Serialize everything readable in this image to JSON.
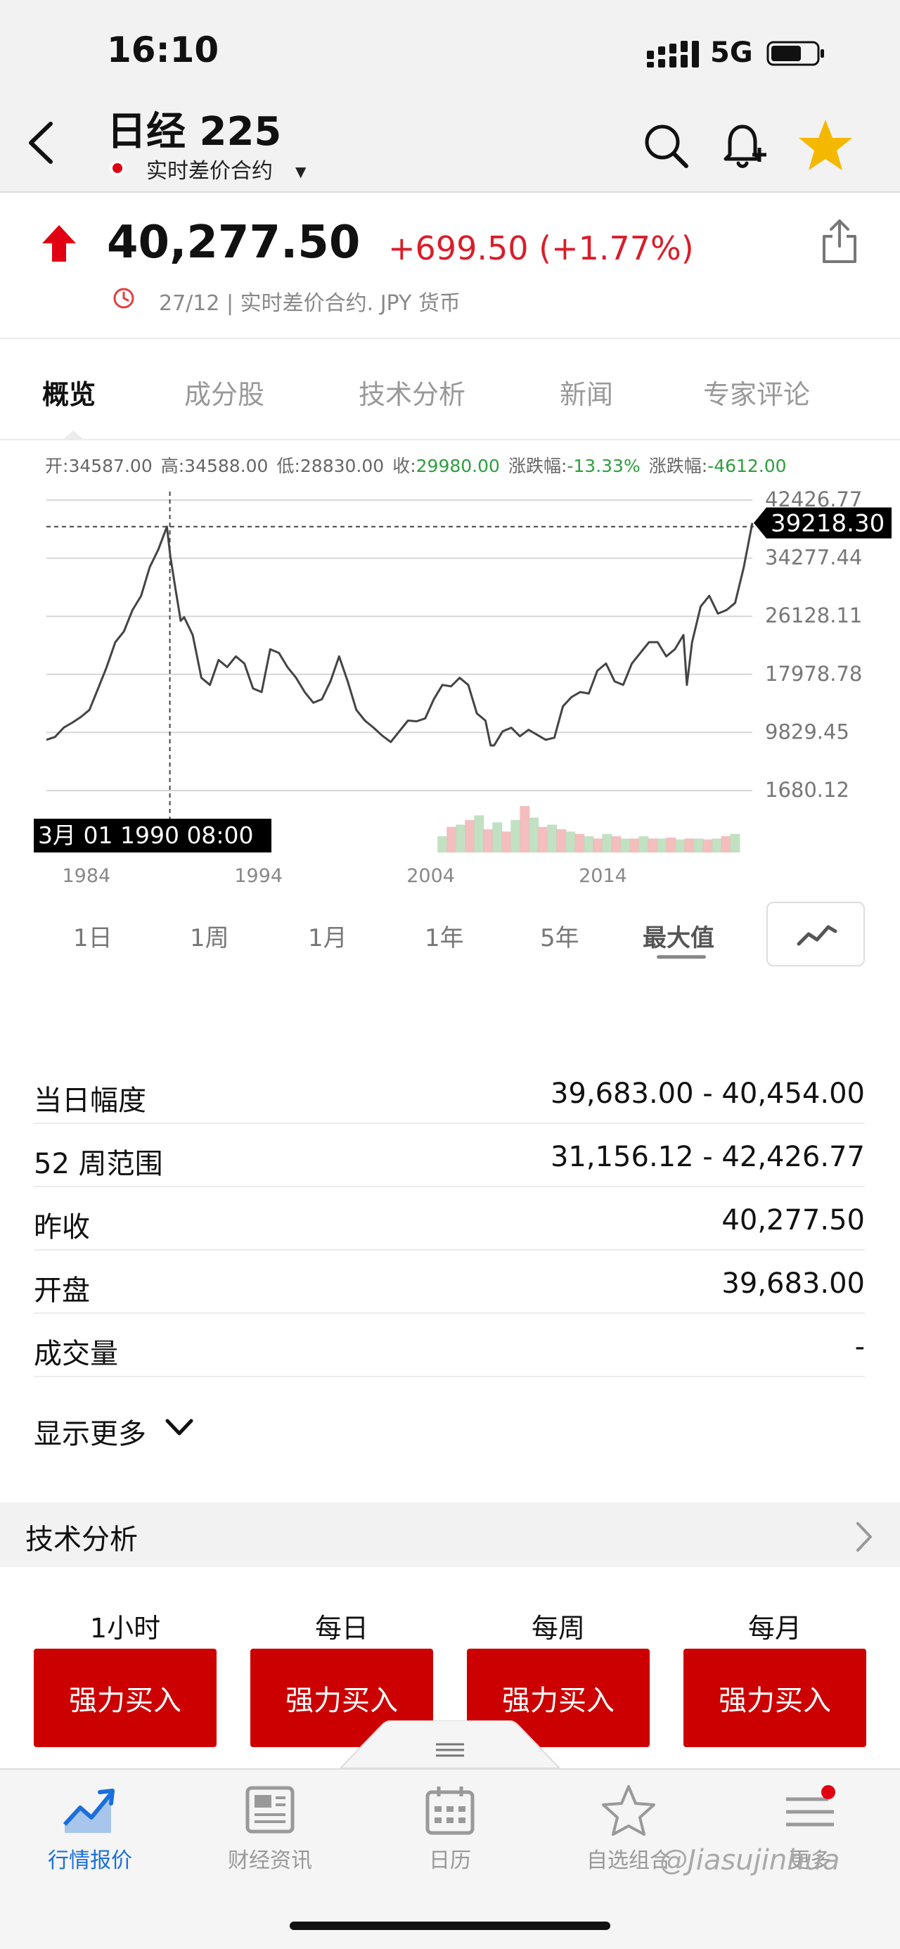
{
  "status": {
    "time": "16:10",
    "network": "5G"
  },
  "header": {
    "title": "日经 225",
    "subtitle": "实时差价合约"
  },
  "quote": {
    "price": "40,277.50",
    "change": "+699.50 (+1.77%)",
    "meta": "27/12 | 实时差价合约. JPY 货币"
  },
  "tabs": [
    {
      "label": "概览",
      "active": true
    },
    {
      "label": "成分股"
    },
    {
      "label": "技术分析"
    },
    {
      "label": "新闻"
    },
    {
      "label": "专家评论"
    }
  ],
  "chart_header": {
    "open_label": "开:",
    "open": "34587.00",
    "high_label": "高:",
    "high": "34588.00",
    "low_label": "低:",
    "low": "28830.00",
    "close_label": "收:",
    "close": "29980.00",
    "pct_label": "涨跌幅:",
    "pct": "-13.33%",
    "chg_label": "涨跌幅:",
    "chg": "-4612.00"
  },
  "chart_data": {
    "type": "line",
    "y_ticks": [
      "42426.77",
      "34277.44",
      "26128.11",
      "17978.78",
      "9829.45",
      "1680.12"
    ],
    "y_tick_values": [
      42426.77,
      34277.44,
      26128.11,
      17978.78,
      9829.45,
      1680.12
    ],
    "ylim": [
      1680.12,
      42426.77
    ],
    "x_ticks": [
      "1984",
      "1994",
      "2004",
      "2014"
    ],
    "x_tick_values": [
      1984,
      1994,
      2004,
      2014
    ],
    "xlim": [
      1983,
      2024
    ],
    "crosshair_label": "3月 01 1990 08:00",
    "crosshair_x": 1990.17,
    "crosshair_y": 38700,
    "last_value_label": "39218.30",
    "last_value": 39218.3,
    "x": [
      1983.0,
      1983.5,
      1984.0,
      1984.5,
      1985.0,
      1985.5,
      1986.0,
      1986.5,
      1987.0,
      1987.5,
      1988.0,
      1988.5,
      1989.0,
      1989.5,
      1990.0,
      1990.2,
      1990.5,
      1990.8,
      1991.0,
      1991.5,
      1992.0,
      1992.5,
      1993.0,
      1993.5,
      1994.0,
      1994.5,
      1995.0,
      1995.5,
      1996.0,
      1996.5,
      1997.0,
      1997.5,
      1998.0,
      1998.5,
      1999.0,
      1999.5,
      2000.0,
      2000.5,
      2001.0,
      2001.5,
      2002.0,
      2002.5,
      2003.0,
      2003.5,
      2004.0,
      2004.5,
      2005.0,
      2005.5,
      2006.0,
      2006.5,
      2007.0,
      2007.5,
      2008.0,
      2008.5,
      2008.8,
      2009.0,
      2009.5,
      2010.0,
      2010.5,
      2011.0,
      2011.5,
      2012.0,
      2012.5,
      2013.0,
      2013.5,
      2014.0,
      2014.5,
      2015.0,
      2015.5,
      2016.0,
      2016.5,
      2017.0,
      2017.5,
      2018.0,
      2018.5,
      2019.0,
      2019.5,
      2020.0,
      2020.2,
      2020.5,
      2021.0,
      2021.5,
      2022.0,
      2022.5,
      2023.0,
      2023.5,
      2024.0
    ],
    "values": [
      8800,
      9200,
      10500,
      11200,
      12000,
      13000,
      16000,
      19000,
      22500,
      24000,
      27000,
      29000,
      33000,
      35500,
      38700,
      34500,
      29900,
      25500,
      26000,
      23500,
      17500,
      16500,
      20000,
      19000,
      20500,
      19500,
      16000,
      15500,
      21500,
      21000,
      19000,
      17500,
      15500,
      14000,
      14500,
      17000,
      20500,
      17000,
      13000,
      11500,
      10500,
      9400,
      8500,
      10000,
      11500,
      11400,
      11800,
      14500,
      16500,
      16300,
      17500,
      16500,
      12500,
      11500,
      8000,
      8000,
      10000,
      10500,
      9300,
      10200,
      9500,
      8800,
      9100,
      13500,
      14800,
      15500,
      15300,
      18500,
      19500,
      17000,
      16500,
      19500,
      21000,
      22500,
      22500,
      20500,
      21500,
      23500,
      16500,
      22500,
      27500,
      29000,
      26500,
      27000,
      28000,
      33000,
      39218.3
    ],
    "volume_range": [
      2006,
      2023
    ],
    "volume": [
      0.35,
      0.55,
      0.6,
      0.7,
      0.8,
      0.5,
      0.65,
      0.45,
      0.7,
      1.0,
      0.75,
      0.55,
      0.6,
      0.5,
      0.45,
      0.4,
      0.35,
      0.3,
      0.4,
      0.35,
      0.3,
      0.3,
      0.35,
      0.3,
      0.3,
      0.32,
      0.28,
      0.3,
      0.3,
      0.28,
      0.3,
      0.35,
      0.4
    ]
  },
  "ranges": {
    "items": [
      "1日",
      "1周",
      "1月",
      "1年",
      "5年",
      "最大值"
    ],
    "active_index": 5
  },
  "stats": [
    {
      "label": "当日幅度",
      "value": "39,683.00 - 40,454.00"
    },
    {
      "label": "52 周范围",
      "value": "31,156.12 - 42,426.77"
    },
    {
      "label": "昨收",
      "value": "40,277.50"
    },
    {
      "label": "开盘",
      "value": "39,683.00"
    },
    {
      "label": "成交量",
      "value": "-"
    }
  ],
  "show_more": "显示更多",
  "technical": {
    "title": "技术分析",
    "timeframes": [
      "1小时",
      "每日",
      "每周",
      "每月"
    ],
    "signals": [
      "强力买入",
      "强力买入",
      "强力买入",
      "强力买入"
    ]
  },
  "nav": {
    "items": [
      "行情报价",
      "财经资讯",
      "日历",
      "自选组合",
      "更多"
    ],
    "active_index": 0
  },
  "watermark": "@Jiasujinhua",
  "colors": {
    "up": "#d81e2a",
    "down": "#2e9e3e",
    "accent": "#1a6fdc",
    "signal": "#cc0000",
    "star": "#f5b800"
  }
}
